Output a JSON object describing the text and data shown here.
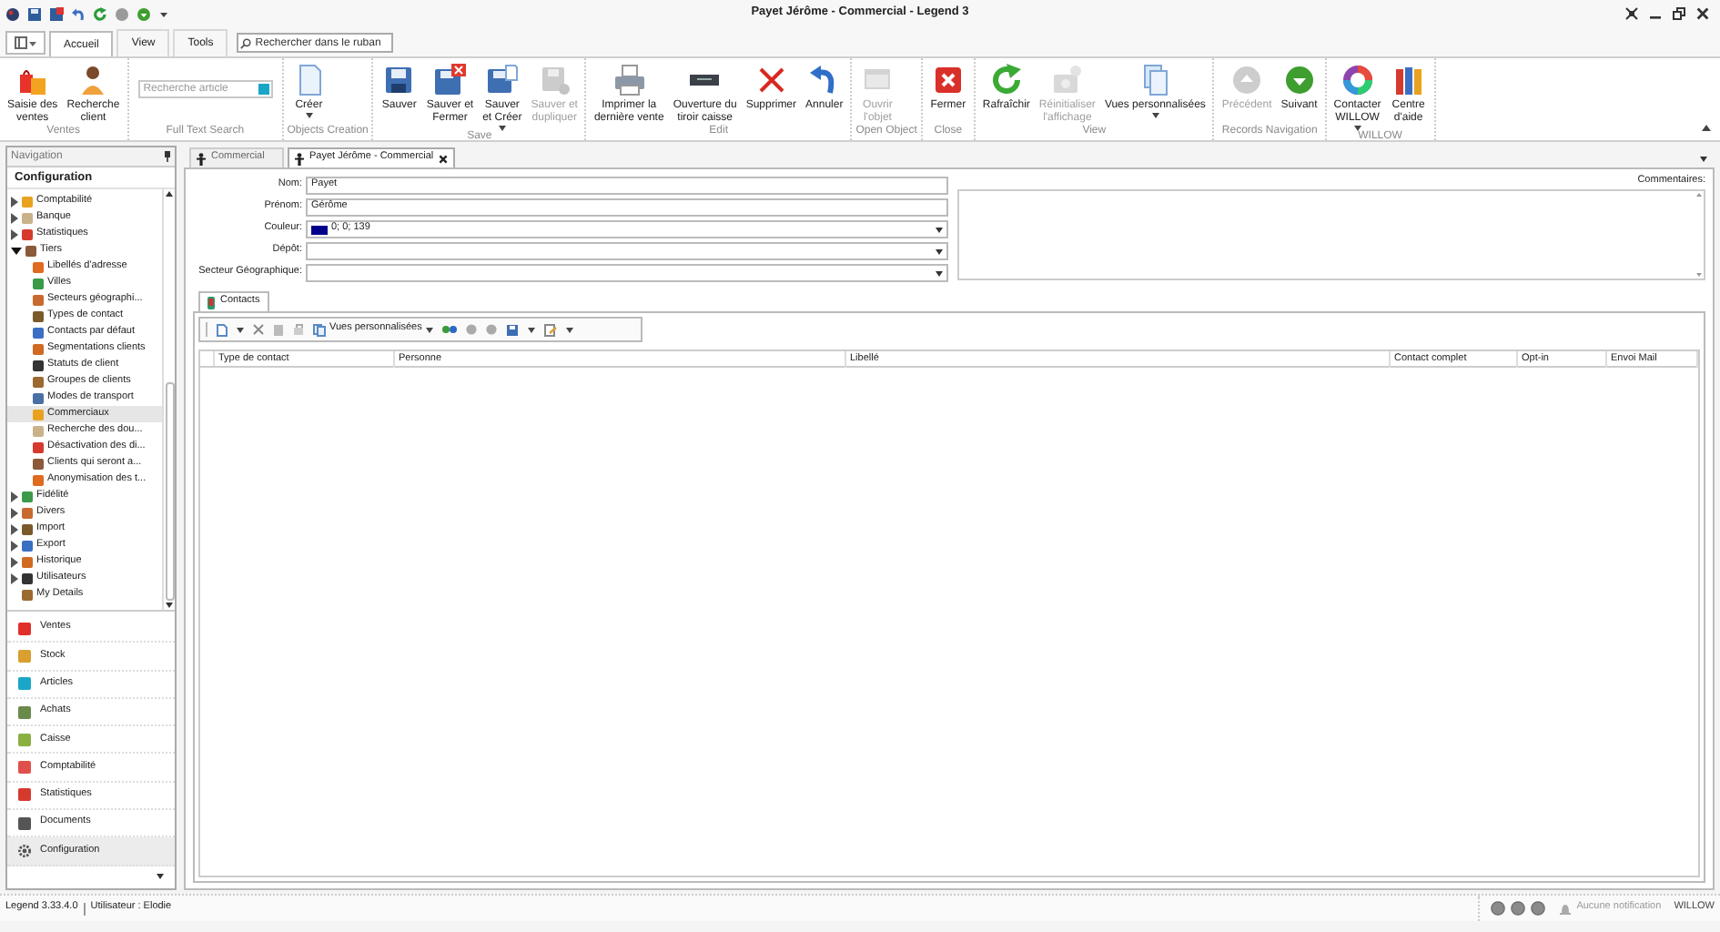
{
  "window": {
    "title": "Payet Jérôme - Commercial - Legend 3"
  },
  "ribbon": {
    "tabs": [
      {
        "label": "Accueil",
        "selected": true
      },
      {
        "label": "View",
        "selected": false
      },
      {
        "label": "Tools",
        "selected": false
      }
    ],
    "search": {
      "placeholder": "Rechercher dans le ruban"
    },
    "groups": [
      {
        "label": "Ventes",
        "items": [
          {
            "kind": "button",
            "label": "Saisie des\nventes",
            "disabled": false,
            "dropdown": false
          },
          {
            "kind": "button",
            "label": "Recherche\nclient",
            "disabled": false,
            "dropdown": false
          }
        ]
      },
      {
        "label": "Full Text Search",
        "items": [
          {
            "kind": "search",
            "placeholder": "Recherche article"
          }
        ]
      },
      {
        "label": "Objects Creation",
        "items": [
          {
            "kind": "button",
            "label": "Créer",
            "disabled": false,
            "dropdown": true
          }
        ]
      },
      {
        "label": "Save",
        "items": [
          {
            "kind": "button",
            "label": "Sauver",
            "disabled": false,
            "dropdown": false
          },
          {
            "kind": "button",
            "label": "Sauver et\nFermer",
            "disabled": false,
            "dropdown": false
          },
          {
            "kind": "button",
            "label": "Sauver\net Créer",
            "disabled": false,
            "dropdown": true
          },
          {
            "kind": "button",
            "label": "Sauver et\ndupliquer",
            "disabled": true,
            "dropdown": false
          }
        ]
      },
      {
        "label": "Edit",
        "items": [
          {
            "kind": "button",
            "label": "Imprimer la\ndernière vente",
            "disabled": false,
            "dropdown": false
          },
          {
            "kind": "button",
            "label": "Ouverture du\ntiroir caisse",
            "disabled": false,
            "dropdown": false
          },
          {
            "kind": "button",
            "label": "Supprimer",
            "disabled": false,
            "dropdown": false
          },
          {
            "kind": "button",
            "label": "Annuler",
            "disabled": false,
            "dropdown": false
          }
        ]
      },
      {
        "label": "Open Object",
        "items": [
          {
            "kind": "button",
            "label": "Ouvrir\nl'objet",
            "disabled": true,
            "dropdown": false
          }
        ]
      },
      {
        "label": "Close",
        "items": [
          {
            "kind": "button",
            "label": "Fermer",
            "disabled": false,
            "dropdown": false
          }
        ]
      },
      {
        "label": "View",
        "items": [
          {
            "kind": "button",
            "label": "Rafraîchir",
            "disabled": false,
            "dropdown": false
          },
          {
            "kind": "button",
            "label": "Réinitialiser\nl'affichage",
            "disabled": true,
            "dropdown": false
          },
          {
            "kind": "button",
            "label": "Vues personnalisées",
            "disabled": false,
            "dropdown": true
          }
        ]
      },
      {
        "label": "Records Navigation",
        "items": [
          {
            "kind": "button",
            "label": "Précédent",
            "disabled": true,
            "dropdown": false
          },
          {
            "kind": "button",
            "label": "Suivant",
            "disabled": false,
            "dropdown": false
          }
        ]
      },
      {
        "label": "WILLOW",
        "items": [
          {
            "kind": "button",
            "label": "Contacter\nWILLOW",
            "disabled": false,
            "dropdown": true
          },
          {
            "kind": "button",
            "label": "Centre\nd'aide",
            "disabled": false,
            "dropdown": false
          }
        ]
      }
    ]
  },
  "navigation": {
    "title": "Navigation",
    "section": "Configuration",
    "tree": [
      {
        "label": "Comptabilité",
        "kind": "folder",
        "selected": false
      },
      {
        "label": "Banque",
        "kind": "folder",
        "selected": false
      },
      {
        "label": "Statistiques",
        "kind": "folder",
        "selected": false
      },
      {
        "label": "Tiers",
        "kind": "folder",
        "expanded": true,
        "selected": false,
        "children": [
          {
            "label": "Libellés d'adresse",
            "selected": false
          },
          {
            "label": "Villes",
            "selected": false
          },
          {
            "label": "Secteurs géographi...",
            "selected": false
          },
          {
            "label": "Types de contact",
            "selected": false
          },
          {
            "label": "Contacts par défaut",
            "selected": false
          },
          {
            "label": "Segmentations clients",
            "selected": false
          },
          {
            "label": "Statuts de client",
            "selected": false
          },
          {
            "label": "Groupes de clients",
            "selected": false
          },
          {
            "label": "Modes de transport",
            "selected": false
          },
          {
            "label": "Commerciaux",
            "selected": true
          },
          {
            "label": "Recherche des dou...",
            "selected": false
          },
          {
            "label": "Désactivation des di...",
            "selected": false
          },
          {
            "label": "Clients qui seront a...",
            "selected": false
          },
          {
            "label": "Anonymisation des t...",
            "selected": false
          }
        ]
      },
      {
        "label": "Fidélité",
        "kind": "folder",
        "selected": false
      },
      {
        "label": "Divers",
        "kind": "folder",
        "selected": false
      },
      {
        "label": "Import",
        "kind": "folder",
        "selected": false
      },
      {
        "label": "Export",
        "kind": "folder",
        "selected": false
      },
      {
        "label": "Historique",
        "kind": "folder",
        "selected": false
      },
      {
        "label": "Utilisateurs",
        "kind": "folder",
        "selected": false
      },
      {
        "label": "My Details",
        "kind": "leaf",
        "selected": false
      }
    ],
    "modules": [
      {
        "label": "Ventes",
        "selected": false
      },
      {
        "label": "Stock",
        "selected": false
      },
      {
        "label": "Articles",
        "selected": false
      },
      {
        "label": "Achats",
        "selected": false
      },
      {
        "label": "Caisse",
        "selected": false
      },
      {
        "label": "Comptabilité",
        "selected": false
      },
      {
        "label": "Statistiques",
        "selected": false
      },
      {
        "label": "Documents",
        "selected": false
      },
      {
        "label": "Configuration",
        "selected": true
      }
    ]
  },
  "documents": [
    {
      "label": "Commercial",
      "selected": false
    },
    {
      "label": "Payet Jérôme - Commercial",
      "selected": true
    }
  ],
  "form": {
    "fields": [
      {
        "label": "Nom:",
        "kind": "text",
        "value": "Payet"
      },
      {
        "label": "Prénom:",
        "kind": "text",
        "value": "Gérôme"
      },
      {
        "label": "Couleur:",
        "kind": "color",
        "value": "0; 0; 139",
        "color": "#00008b"
      },
      {
        "label": "Dépôt:",
        "kind": "select"
      },
      {
        "label": "Secteur Géographique:",
        "kind": "select"
      }
    ],
    "comments_label": "Commentaires:"
  },
  "subtabs": [
    {
      "label": "Contacts",
      "selected": true
    }
  ],
  "contacts": {
    "views_button": "Vues personnalisées",
    "columns": [
      "Type de contact",
      "Personne",
      "Libellé",
      "Contact complet",
      "Opt-in",
      "Envoi Mail"
    ]
  },
  "status_bar": {
    "version": "Legend 3.33.4.0",
    "user": "Utilisateur : Elodie",
    "notification": "Aucune notification",
    "brand": "WILLOW"
  }
}
